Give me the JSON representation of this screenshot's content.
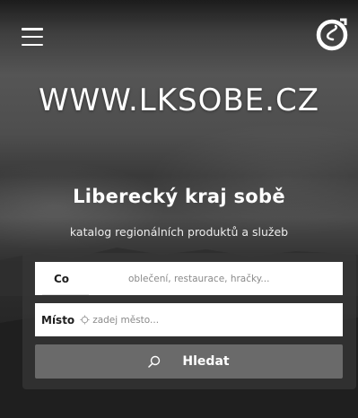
{
  "header": {
    "menu_icon": "hamburger-menu-icon",
    "logo_icon": "lksobe-logo-icon"
  },
  "hero": {
    "site_url": "WWW.LKSOBE.CZ",
    "title": "Liberecký kraj sobě",
    "subtitle": "katalog regionálních produktů a služeb"
  },
  "search": {
    "what_label": "Co",
    "what_placeholder": "oblečení, restaurace, hračky...",
    "where_label": "Místo",
    "where_placeholder": "zadej město...",
    "where_icon": "location-pin-icon",
    "submit_label": "Hledat",
    "submit_icon": "search-icon"
  },
  "colors": {
    "button": "#6a6a6a",
    "panel": "#373737",
    "text": "#ffffff"
  }
}
